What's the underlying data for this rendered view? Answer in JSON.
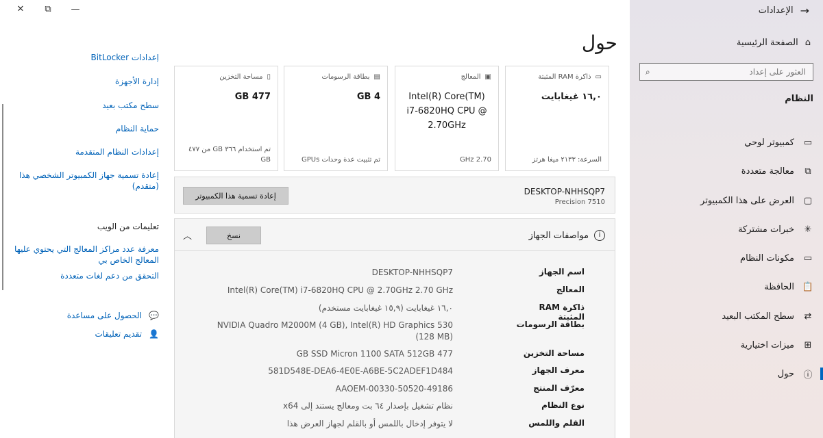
{
  "window": {
    "minimize_icon": "minimize-icon",
    "restore_icon": "restore-icon",
    "close_icon": "close-icon"
  },
  "nav": {
    "back_label": "الإعدادات",
    "home_label": "الصفحة الرئيسية",
    "search_placeholder": "العثور على إعداد",
    "section_title": "النظام",
    "items": [
      {
        "label": "كمبيوتر لوحي",
        "icon": "tablet-icon"
      },
      {
        "label": "معالجة متعددة",
        "icon": "multitasking-icon"
      },
      {
        "label": "العرض على هذا الكمبيوتر",
        "icon": "project-icon"
      },
      {
        "label": "خبرات مشتركة",
        "icon": "shared-icon"
      },
      {
        "label": "مكونات النظام",
        "icon": "components-icon"
      },
      {
        "label": "الحافظة",
        "icon": "clipboard-icon"
      },
      {
        "label": "سطح المكتب البعيد",
        "icon": "remote-icon"
      },
      {
        "label": "ميزات اختيارية",
        "icon": "features-icon"
      },
      {
        "label": "حول",
        "icon": "about-icon"
      }
    ],
    "accent_color": "#0067c0"
  },
  "page": {
    "title": "حول"
  },
  "cards": [
    {
      "label": "ذاكرة RAM المثبتة",
      "value": "١٦,٠ غيغابايت",
      "sub": "السرعة: ٢١٣٣ ميغا هرتز"
    },
    {
      "label": "المعالج",
      "value": "Intel(R) Core(TM) i7-6820HQ CPU @ 2.70GHz",
      "sub": "2.70 GHz"
    },
    {
      "label": "بطاقة الرسومات",
      "value": "4 GB",
      "sub": "تم تثبيت عدة وحدات GPUs"
    },
    {
      "label": "مساحة التخزين",
      "value": "477 GB",
      "sub": "تم استخدام ٣٦٦ GB من ٤٧٧ GB"
    }
  ],
  "pc": {
    "name": "DESKTOP-NHHSQP7",
    "model": "Precision 7510",
    "rename_label": "إعادة تسمية هذا الكمبيوتر"
  },
  "specs": {
    "title": "مواصفات الجهاز",
    "copy_label": "نسخ",
    "rows": [
      {
        "key": "اسم الجهاز",
        "value": "DESKTOP-NHHSQP7"
      },
      {
        "key": "المعالج",
        "value": "Intel(R) Core(TM) i7-6820HQ CPU @ 2.70GHz   2.70 GHz"
      },
      {
        "key": "ذاكرة RAM المثبتة",
        "value": "١٦,٠ غيغابايت (١٥,٩ غيغابايت مستخدم)"
      },
      {
        "key": "بطاقة الرسومات",
        "value": "NVIDIA Quadro M2000M (4 GB), Intel(R) HD Graphics 530 (128 MB)"
      },
      {
        "key": "مساحة التخزين",
        "value": "477 GB SSD Micron 1100 SATA 512GB"
      },
      {
        "key": "معرف الجهاز",
        "value": "581D548E-DEA6-4E0E-A6BE-5C2ADEF1D484"
      },
      {
        "key": "معرّف المنتج",
        "value": "00330-50520-49186-AAOEM"
      },
      {
        "key": "نوع النظام",
        "value": "نظام تشغيل بإصدار ٦٤ بت ومعالج يستند إلى x64"
      },
      {
        "key": "القلم واللمس",
        "value": "لا يتوفر إدخال باللمس أو بالقلم لجهاز العرض هذا"
      }
    ]
  },
  "related": {
    "links": [
      "إعدادات BitLocker",
      "إدارة الأجهزة",
      "سطح مكتب بعيد",
      "حماية النظام",
      "إعدادات النظام المتقدمة",
      "إعادة تسمية جهاز الكمبيوتر الشخصي هذا (متقدم)"
    ],
    "web_help_title": "تعليمات من الويب",
    "web_links": [
      "معرفة عدد مراكز المعالج التي يحتوي عليها المعالج الخاص بي",
      "التحقق من دعم لغات متعددة"
    ],
    "get_help": "الحصول على مساعدة",
    "feedback": "تقديم تعليقات"
  }
}
